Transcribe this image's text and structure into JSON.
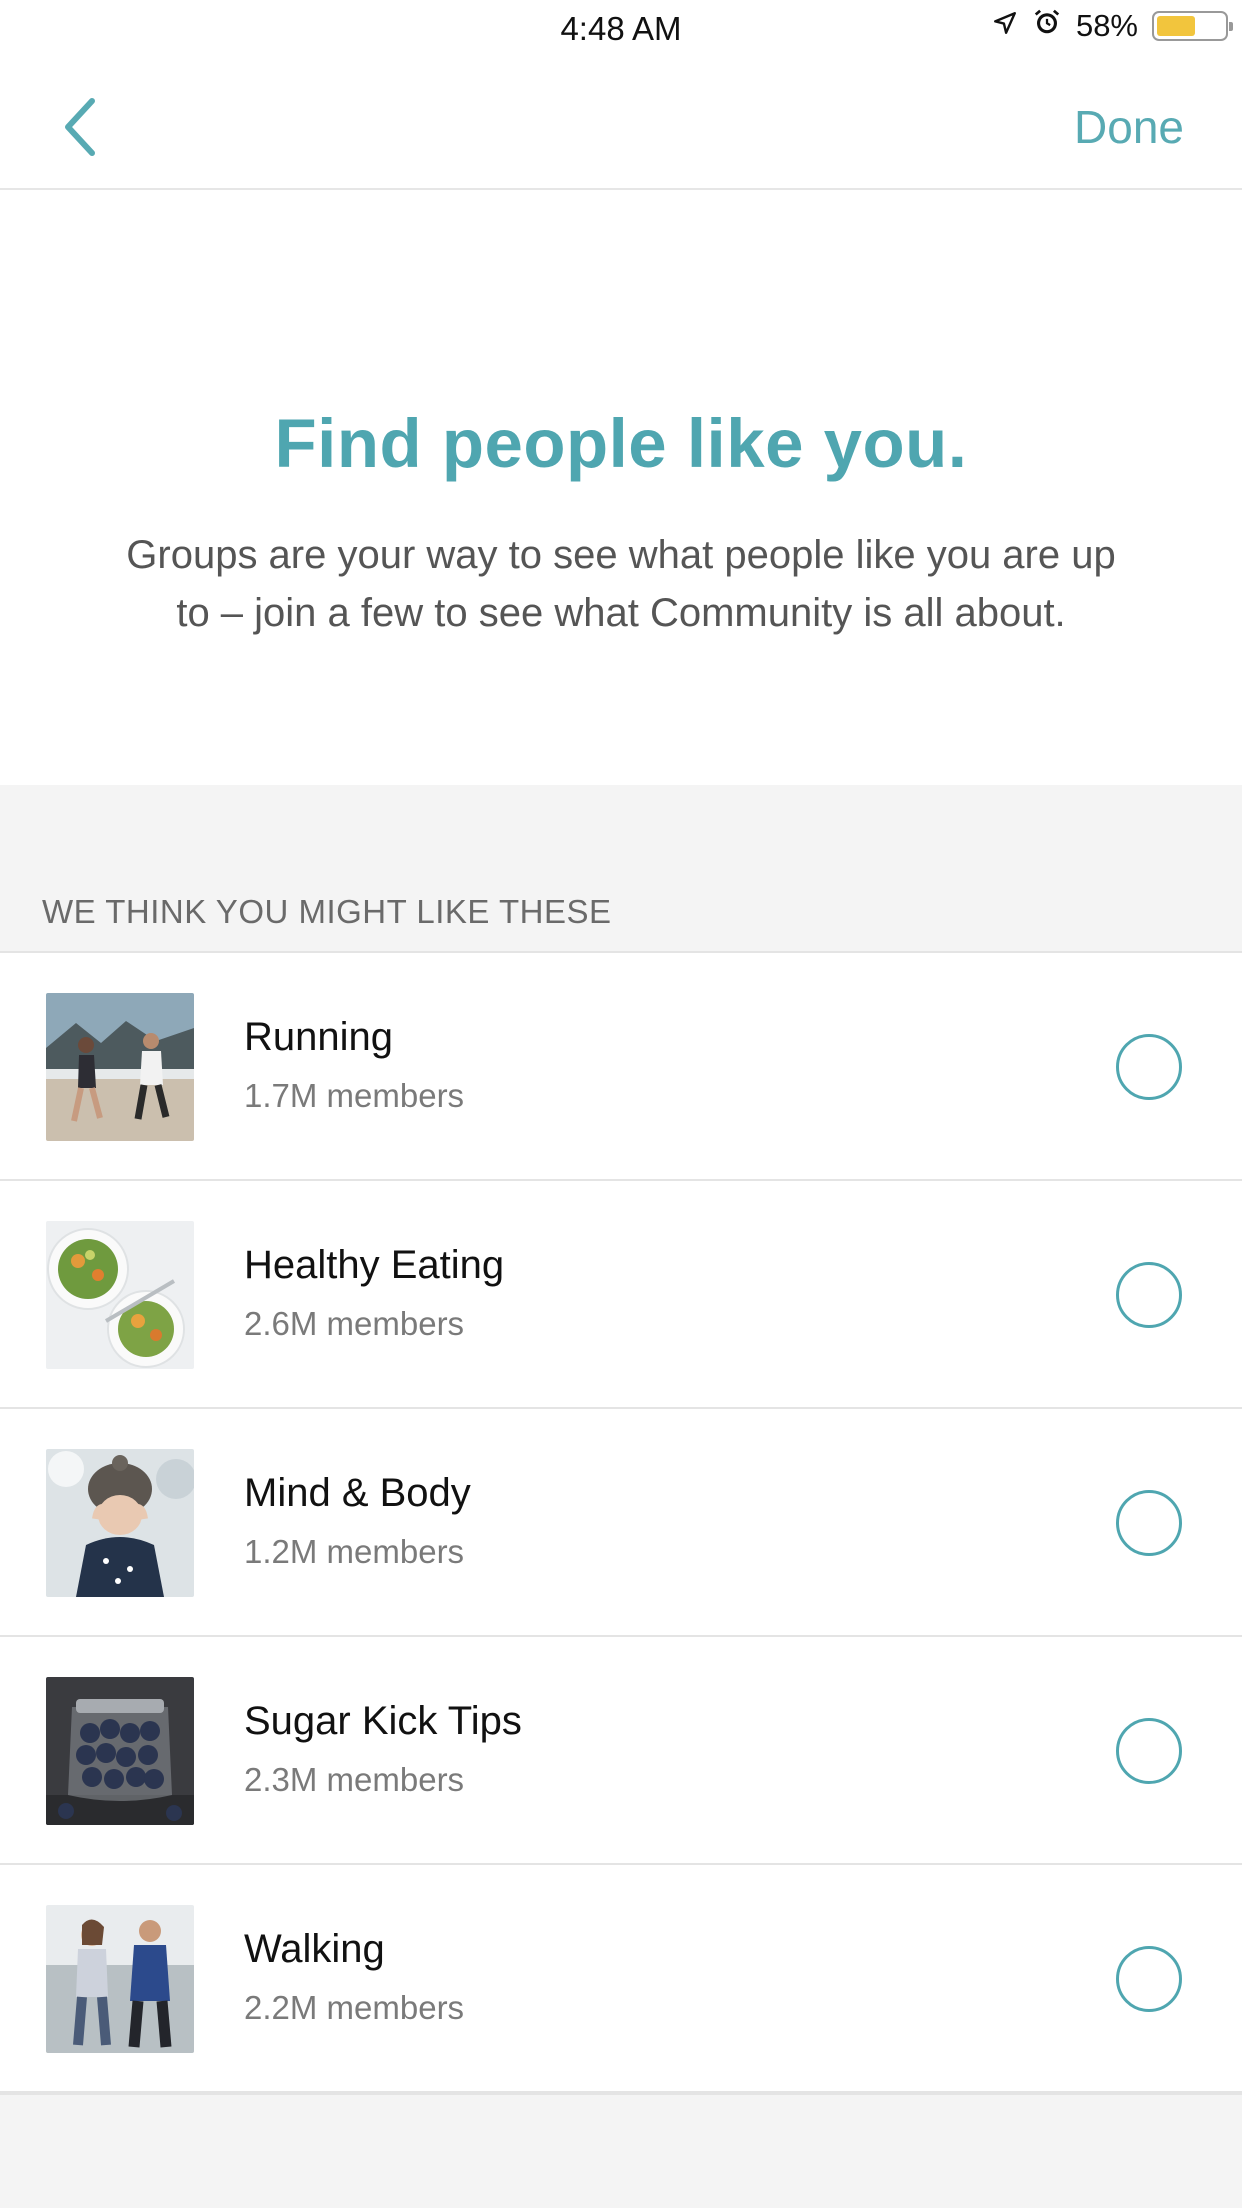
{
  "status_bar": {
    "time": "4:48 AM",
    "battery": "58%",
    "battery_level": 0.58,
    "icons": [
      "location-icon",
      "alarm-icon",
      "battery-icon"
    ]
  },
  "nav": {
    "back_icon": "chevron-left-icon",
    "done_label": "Done"
  },
  "hero": {
    "title": "Find people like you.",
    "subtitle": "Groups are your way to see what people like you are up to – join a few to see what Community is all about."
  },
  "section": {
    "header": "WE THINK YOU MIGHT LIKE THESE"
  },
  "groups": [
    {
      "title": "Running",
      "members": "1.7M members",
      "image": "runners-on-beach",
      "checked": false
    },
    {
      "title": "Healthy Eating",
      "members": "2.6M members",
      "image": "salad-bowls",
      "checked": false
    },
    {
      "title": "Mind & Body",
      "members": "1.2M members",
      "image": "woman-in-snow",
      "checked": false
    },
    {
      "title": "Sugar Kick Tips",
      "members": "2.3M members",
      "image": "blueberry-jar",
      "checked": false
    },
    {
      "title": "Walking",
      "members": "2.2M members",
      "image": "couple-walking",
      "checked": false
    }
  ],
  "colors": {
    "accent": "#4fa6b0",
    "section_bg": "#f4f4f4",
    "battery": "#f2c53d"
  }
}
